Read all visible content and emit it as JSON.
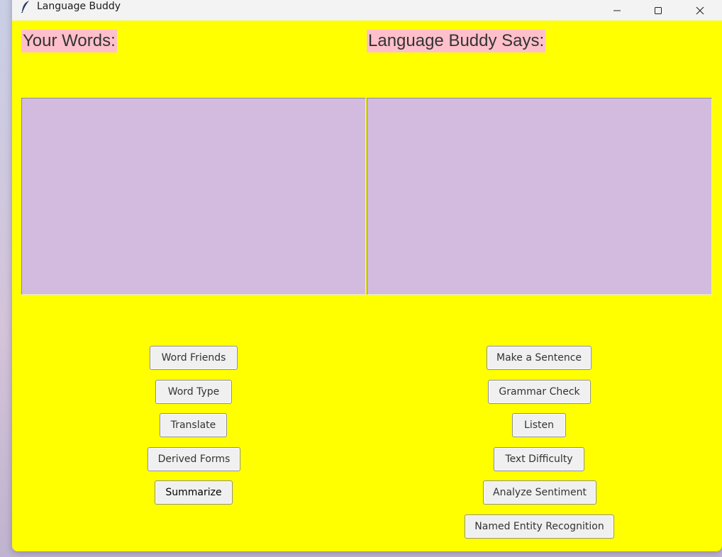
{
  "window": {
    "title": "Language Buddy",
    "controls": {
      "minimize": "—",
      "maximize": "☐",
      "close": "✕"
    }
  },
  "colors": {
    "background": "#ffff00",
    "heading_bg": "#ffc0cb",
    "textpane_bg": "#d3badf",
    "button_bg": "#f0f0f0"
  },
  "left": {
    "heading": "Your Words:",
    "input_text": "",
    "buttons": [
      "Word Friends",
      "Word Type",
      "Translate",
      "Derived Forms",
      "Summarize"
    ]
  },
  "right": {
    "heading": "Language Buddy Says:",
    "output_text": "",
    "buttons": [
      "Make a Sentence",
      "Grammar Check",
      "Listen",
      "Text Difficulty",
      "Analyze Sentiment",
      "Named Entity Recognition"
    ]
  }
}
